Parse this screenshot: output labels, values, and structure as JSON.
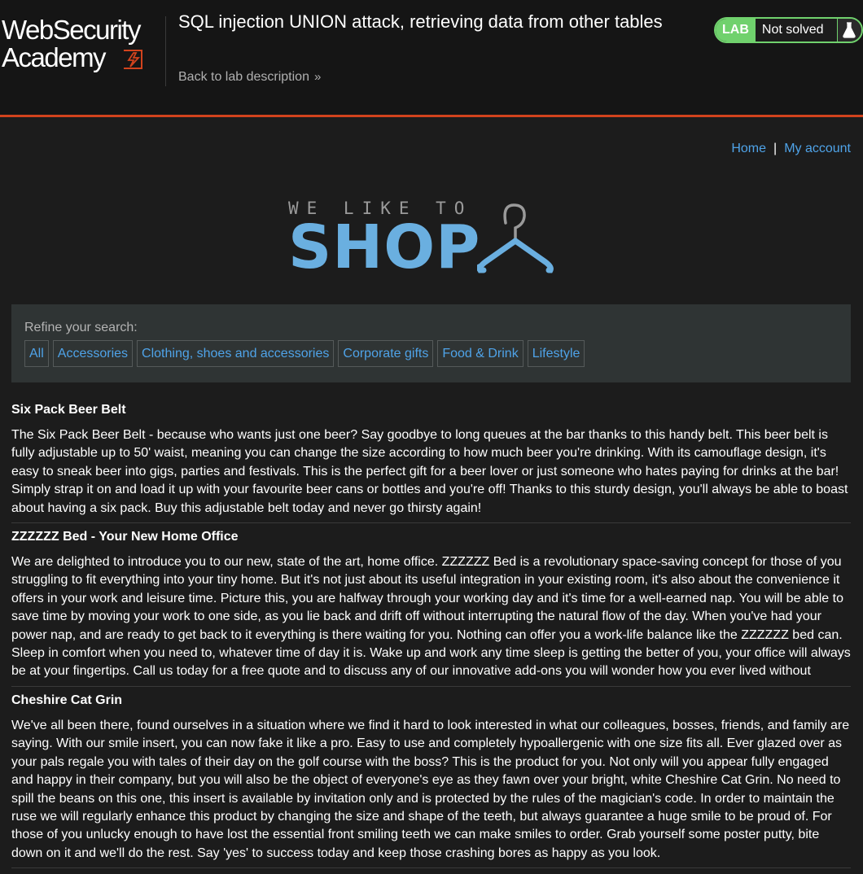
{
  "academy": {
    "logo_line1": "WebSecurity",
    "logo_line2": "Academy",
    "lab_title": "SQL injection UNION attack, retrieving data from other tables",
    "back_link": "Back to lab description",
    "lab_badge": "LAB",
    "lab_status": "Not solved",
    "accent_color": "#d2431d",
    "status_color": "#70d16d",
    "icons": [
      "lightning-bolt-icon",
      "double-chevron-right-icon",
      "flask-icon"
    ]
  },
  "nav": {
    "home": "Home",
    "separator": "|",
    "my_account": "My account"
  },
  "shop_logo": {
    "tagline": "WE LIKE TO",
    "word": "SHOP",
    "icon": "hanger-icon",
    "color": "#6aafe0"
  },
  "filters": {
    "label": "Refine your search:",
    "categories": [
      "All",
      "Accessories",
      "Clothing, shoes and accessories",
      "Corporate gifts",
      "Food & Drink",
      "Lifestyle"
    ]
  },
  "products": [
    {
      "title": "Six Pack Beer Belt",
      "description": "The Six Pack Beer Belt - because who wants just one beer? Say goodbye to long queues at the bar thanks to this handy belt. This beer belt is fully adjustable up to 50' waist, meaning you can change the size according to how much beer you're drinking. With its camouflage design, it's easy to sneak beer into gigs, parties and festivals. This is the perfect gift for a beer lover or just someone who hates paying for drinks at the bar! Simply strap it on and load it up with your favourite beer cans or bottles and you're off! Thanks to this sturdy design, you'll always be able to boast about having a six pack. Buy this adjustable belt today and never go thirsty again!"
    },
    {
      "title": "ZZZZZZ Bed - Your New Home Office",
      "description": "We are delighted to introduce you to our new, state of the art, home office. ZZZZZZ Bed is a revolutionary space-saving concept for those of you struggling to fit everything into your tiny home. But it's not just about its useful integration in your existing room, it's also about the convenience it offers in your work and leisure time. Picture this, you are halfway through your working day and it's time for a well-earned nap. You will be able to save time by moving your work to one side, as you lie back and drift off without interrupting the natural flow of the day. When you've had your power nap, and are ready to get back to it everything is there waiting for you. Nothing can offer you a work-life balance like the ZZZZZZ bed can. Sleep in comfort when you need to, whatever time of day it is. Wake up and work any time sleep is getting the better of you, your office will always be at your fingertips. Call us today for a free quote and to discuss any of our innovative add-ons you will wonder how you ever lived without"
    },
    {
      "title": "Cheshire Cat Grin",
      "description": "We've all been there, found ourselves in a situation where we find it hard to look interested in what our colleagues, bosses, friends, and family are saying. With our smile insert, you can now fake it like a pro. Easy to use and completely hypoallergenic with one size fits all. Ever glazed over as your pals regale you with tales of their day on the golf course with the boss? This is the product for you. Not only will you appear fully engaged and happy in their company, but you will also be the object of everyone's eye as they fawn over your bright, white Cheshire Cat Grin. No need to spill the beans on this one, this insert is available by invitation only and is protected by the rules of the magician's code. In order to maintain the ruse we will regularly enhance this product by changing the size and shape of the teeth, but always guarantee a huge smile to be proud of. For those of you unlucky enough to have lost the essential front smiling teeth we can make smiles to order. Grab yourself some poster putty, bite down on it and we'll do the rest. Say 'yes' to success today and keep those crashing bores as happy as you look."
    }
  ]
}
